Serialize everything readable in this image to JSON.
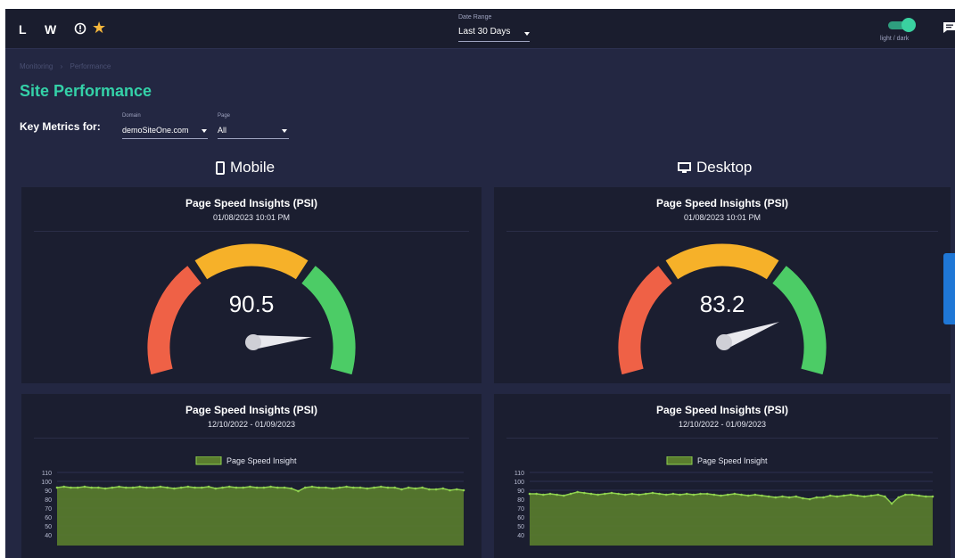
{
  "header": {
    "logo_letter_1": "L",
    "logo_letter_2": "W",
    "info_icon": "info-circle-icon",
    "star_icon": "star-icon",
    "date_range": {
      "label": "Date Range",
      "value": "Last 30 Days"
    },
    "theme_toggle": {
      "label": "light / dark",
      "state": "on"
    },
    "chat_icon": "chat-icon"
  },
  "breadcrumb": [
    "Monitoring",
    "›",
    "Performance"
  ],
  "page_title": "Site Performance",
  "filters": {
    "key_metrics_label": "Key Metrics for:",
    "domain": {
      "label": "Domain",
      "value": "demoSiteOne.com"
    },
    "page": {
      "label": "Page",
      "value": "All"
    }
  },
  "sections": {
    "mobile": {
      "title": "Mobile",
      "icon": "mobile-phone-icon"
    },
    "desktop": {
      "title": "Desktop",
      "icon": "monitor-icon"
    }
  },
  "cards": {
    "mobile_gauge": {
      "title": "Page Speed Insights (PSI)",
      "subtitle": "01/08/2023 10:01 PM",
      "value": "90.5"
    },
    "desktop_gauge": {
      "title": "Page Speed Insights (PSI)",
      "subtitle": "01/08/2023 10:01 PM",
      "value": "83.2"
    },
    "mobile_trend": {
      "title": "Page Speed Insights (PSI)",
      "subtitle": "12/10/2022 - 01/09/2023"
    },
    "desktop_trend": {
      "title": "Page Speed Insights (PSI)",
      "subtitle": "12/10/2022 - 01/09/2023"
    }
  },
  "colors": {
    "accent": "#34d1a8",
    "gauge_red": "#ef6146",
    "gauge_orange": "#f6b129",
    "gauge_green": "#4ccc66",
    "trend_fill": "#5a7d2e",
    "trend_line": "#8fd14f"
  },
  "chart_data": [
    {
      "type": "gauge",
      "title": "Page Speed Insights (PSI)",
      "value": 90.5,
      "range": [
        0,
        100
      ]
    },
    {
      "type": "gauge",
      "title": "Page Speed Insights (PSI)",
      "value": 83.2,
      "range": [
        0,
        100
      ]
    },
    {
      "type": "area",
      "title": "Page Speed Insights (PSI)",
      "subtitle": "12/10/2022 - 01/09/2023",
      "legend": "top",
      "ylim": [
        40,
        110
      ],
      "yticks": [
        110,
        100,
        90,
        80,
        70,
        60,
        50,
        40
      ],
      "series": [
        {
          "name": "Page Speed Insight",
          "values": [
            93,
            94,
            93,
            93,
            94,
            93,
            93,
            92,
            93,
            94,
            93,
            93,
            94,
            93,
            93,
            94,
            93,
            92,
            93,
            94,
            93,
            93,
            94,
            92,
            93,
            94,
            93,
            93,
            94,
            93,
            93,
            94,
            93,
            93,
            92,
            89,
            93,
            94,
            93,
            93,
            92,
            93,
            94,
            93,
            93,
            92,
            93,
            94,
            93,
            93,
            91,
            93,
            92,
            93,
            91,
            91,
            92,
            90,
            91,
            90
          ]
        }
      ]
    },
    {
      "type": "area",
      "title": "Page Speed Insights (PSI)",
      "subtitle": "12/10/2022 - 01/09/2023",
      "legend": "top",
      "ylim": [
        40,
        110
      ],
      "yticks": [
        110,
        100,
        90,
        80,
        70,
        60,
        50,
        40
      ],
      "series": [
        {
          "name": "Page Speed Insight",
          "values": [
            86,
            86,
            85,
            86,
            85,
            84,
            86,
            88,
            87,
            86,
            85,
            86,
            87,
            86,
            85,
            86,
            85,
            86,
            87,
            86,
            85,
            86,
            85,
            86,
            85,
            86,
            86,
            85,
            84,
            85,
            86,
            85,
            84,
            85,
            84,
            83,
            82,
            83,
            82,
            83,
            81,
            80,
            82,
            82,
            84,
            83,
            84,
            85,
            84,
            83,
            84,
            85,
            83,
            75,
            82,
            85,
            85,
            84,
            83,
            83
          ]
        }
      ]
    }
  ]
}
